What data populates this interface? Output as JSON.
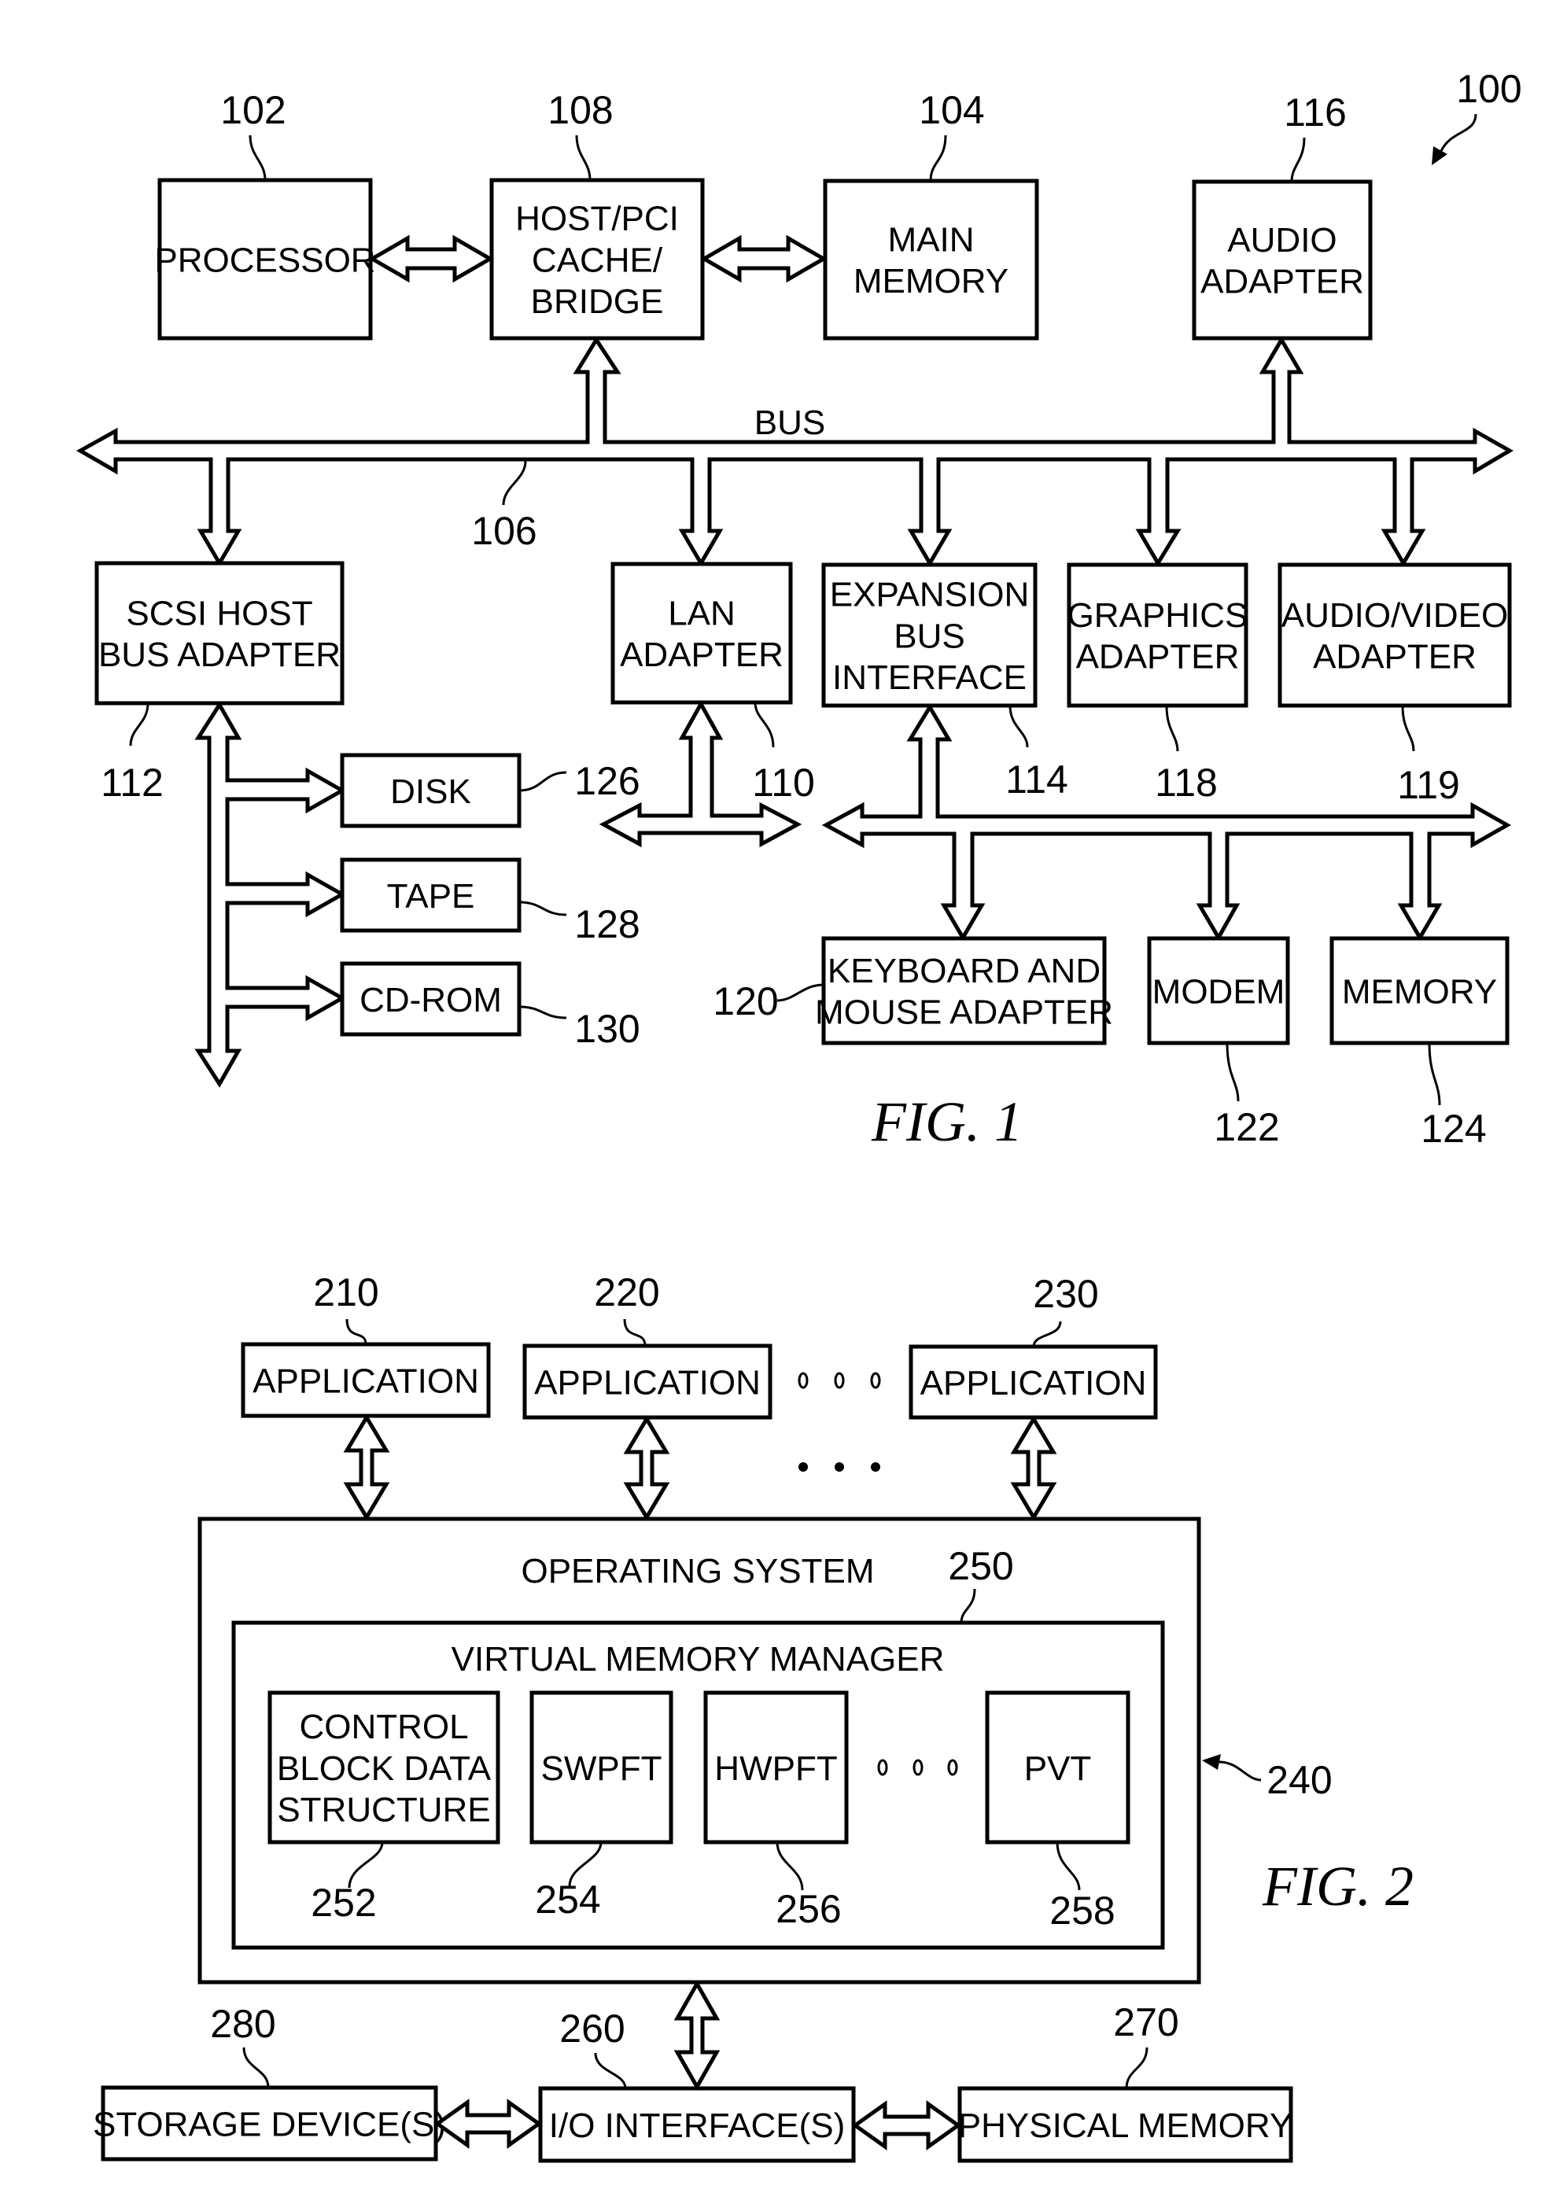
{
  "fig1": {
    "caption": "FIG. 1",
    "system_ref": "100",
    "bus_label": "BUS",
    "bus_ref": "106",
    "boxes": [
      {
        "id": "processor",
        "lines": [
          "PROCESSOR"
        ],
        "ref": "102"
      },
      {
        "id": "host-pci-bridge",
        "lines": [
          "HOST/PCI",
          "CACHE/",
          "BRIDGE"
        ],
        "ref": "108"
      },
      {
        "id": "main-memory",
        "lines": [
          "MAIN",
          "MEMORY"
        ],
        "ref": "104"
      },
      {
        "id": "audio-adapter",
        "lines": [
          "AUDIO",
          "ADAPTER"
        ],
        "ref": "116"
      },
      {
        "id": "scsi-host-bus-adapter",
        "lines": [
          "SCSI HOST",
          "BUS ADAPTER"
        ],
        "ref": "112"
      },
      {
        "id": "lan-adapter",
        "lines": [
          "LAN",
          "ADAPTER"
        ],
        "ref": "110"
      },
      {
        "id": "expansion-bus-interface",
        "lines": [
          "EXPANSION",
          "BUS",
          "INTERFACE"
        ],
        "ref": "114"
      },
      {
        "id": "graphics-adapter",
        "lines": [
          "GRAPHICS",
          "ADAPTER"
        ],
        "ref": "118"
      },
      {
        "id": "audio-video-adapter",
        "lines": [
          "AUDIO/VIDEO",
          "ADAPTER"
        ],
        "ref": "119"
      },
      {
        "id": "disk",
        "lines": [
          "DISK"
        ],
        "ref": "126"
      },
      {
        "id": "tape",
        "lines": [
          "TAPE"
        ],
        "ref": "128"
      },
      {
        "id": "cd-rom",
        "lines": [
          "CD-ROM"
        ],
        "ref": "130"
      },
      {
        "id": "keyboard-mouse-adapter",
        "lines": [
          "KEYBOARD AND",
          "MOUSE ADAPTER"
        ],
        "ref": "120"
      },
      {
        "id": "modem",
        "lines": [
          "MODEM"
        ],
        "ref": "122"
      },
      {
        "id": "memory",
        "lines": [
          "MEMORY"
        ],
        "ref": "124"
      }
    ]
  },
  "fig2": {
    "caption": "FIG. 2",
    "os_label": "OPERATING SYSTEM",
    "os_ref": "240",
    "vmm_label": "VIRTUAL MEMORY MANAGER",
    "vmm_ref": "250",
    "boxes": [
      {
        "id": "application-1",
        "lines": [
          "APPLICATION"
        ],
        "ref": "210"
      },
      {
        "id": "application-2",
        "lines": [
          "APPLICATION"
        ],
        "ref": "220"
      },
      {
        "id": "application-3",
        "lines": [
          "APPLICATION"
        ],
        "ref": "230"
      },
      {
        "id": "control-block-data-structure",
        "lines": [
          "CONTROL",
          "BLOCK DATA",
          "STRUCTURE"
        ],
        "ref": "252"
      },
      {
        "id": "swpft",
        "lines": [
          "SWPFT"
        ],
        "ref": "254"
      },
      {
        "id": "hwpft",
        "lines": [
          "HWPFT"
        ],
        "ref": "256"
      },
      {
        "id": "pvt",
        "lines": [
          "PVT"
        ],
        "ref": "258"
      },
      {
        "id": "storage-devices",
        "lines": [
          "STORAGE DEVICE(S)"
        ],
        "ref": "280"
      },
      {
        "id": "io-interfaces",
        "lines": [
          "I/O INTERFACE(S)"
        ],
        "ref": "260"
      },
      {
        "id": "physical-memory",
        "lines": [
          "PHYSICAL MEMORY"
        ],
        "ref": "270"
      }
    ]
  }
}
